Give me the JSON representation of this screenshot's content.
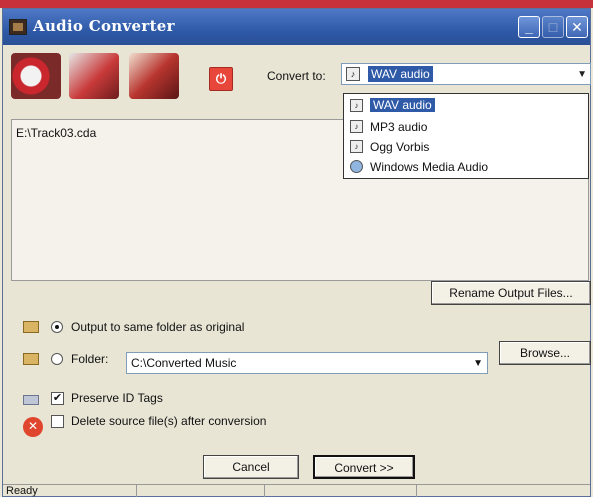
{
  "window": {
    "title": "Audio Converter",
    "accent_color": "#2f5aa8",
    "controls": {
      "minimize_icon": "minimize-icon",
      "maximize_icon": "maximize-icon",
      "close_icon": "close-icon"
    }
  },
  "toolbar": {
    "tools": [
      {
        "name": "add-files-tool",
        "icon": "cd-tracks-icon"
      },
      {
        "name": "remove-files-tool",
        "icon": "trash-icon"
      },
      {
        "name": "audio-tool",
        "icon": "music-icon"
      },
      {
        "name": "stop-tool",
        "icon": "power-icon",
        "glyph": "⏻"
      }
    ],
    "convert_to_label": "Convert to:",
    "format_icon": "audio-file-icon",
    "selected_format": "WAV audio"
  },
  "format_dropdown": {
    "options": [
      {
        "label": "WAV audio",
        "selected": true
      },
      {
        "label": "MP3 audio",
        "selected": false
      },
      {
        "label": "Ogg Vorbis",
        "selected": false
      },
      {
        "label": "Windows Media Audio",
        "selected": false
      }
    ]
  },
  "file_list": {
    "items": [
      "E:\\Track03.cda"
    ]
  },
  "buttons": {
    "rename": "Rename Output Files...",
    "browse": "Browse...",
    "cancel": "Cancel",
    "convert": "Convert >>"
  },
  "output": {
    "same_folder_label": "Output to same folder as original",
    "folder_label": "Folder:",
    "folder_value": "C:\\Converted Music",
    "same_folder_selected": true
  },
  "options": {
    "preserve_tags_label": "Preserve ID Tags",
    "preserve_tags_checked": true,
    "delete_source_label": "Delete source file(s) after conversion",
    "delete_source_checked": false
  },
  "status": {
    "text": "Ready"
  }
}
